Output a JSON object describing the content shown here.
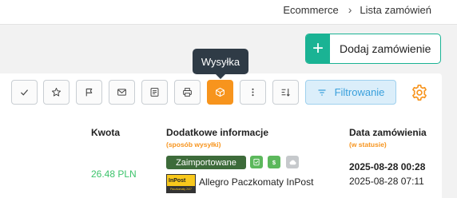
{
  "breadcrumb": {
    "section": "Ecommerce",
    "separator": "›",
    "current": "Lista zamówień"
  },
  "actions": {
    "add_order_label": "Dodaj zamówienie",
    "add_icon": "plus-icon"
  },
  "tooltip": {
    "text": "Wysyłka"
  },
  "toolbar": {
    "buttons": [
      {
        "icon": "check-icon"
      },
      {
        "icon": "star-icon"
      },
      {
        "icon": "flag-icon"
      },
      {
        "icon": "envelope-icon"
      },
      {
        "icon": "document-icon"
      },
      {
        "icon": "printer-icon"
      },
      {
        "icon": "package-icon",
        "active": true
      },
      {
        "icon": "more-vertical-icon"
      },
      {
        "icon": "sort-icon"
      }
    ],
    "filter_label": "Filtrowanie",
    "settings_icon": "gear-icon"
  },
  "colors": {
    "accent_green": "#1ab394",
    "active_orange": "#f7941d",
    "filter_blue": "#3aa0dc",
    "amount_green": "#3cc36b",
    "badge_green": "#3d6b3a"
  },
  "table": {
    "headers": {
      "amount": "Kwota",
      "info": "Dodatkowe informacje",
      "info_sub": "(sposób wysyłki)",
      "date": "Data zamówienia",
      "date_sub": "(w statusie)"
    },
    "rows": [
      {
        "amount": "26.48 PLN",
        "status_badge": "Zaimportowane",
        "status_icons": [
          "invoice-icon",
          "dollar-icon",
          "cloud-icon"
        ],
        "courier_logo_text": "InPost",
        "courier_logo_subtext": "Paczkomaty 24/7",
        "courier": "Allegro Paczkomaty InPost",
        "order_date": "2025-08-28 00:28",
        "status_date": "2025-08-28 07:11"
      }
    ]
  }
}
